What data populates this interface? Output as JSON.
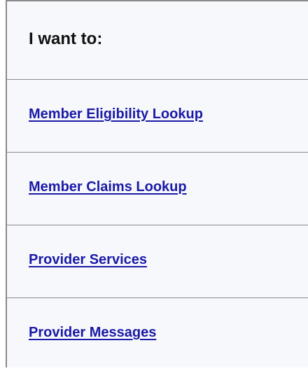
{
  "panel": {
    "title": "I want to:",
    "links": [
      {
        "label": "Member Eligibility Lookup"
      },
      {
        "label": "Member Claims Lookup"
      },
      {
        "label": "Provider Services"
      },
      {
        "label": "Provider Messages"
      }
    ]
  },
  "colors": {
    "link": "#1a1aa6",
    "border": "#8a8a8a",
    "background": "#f7f8fc"
  }
}
